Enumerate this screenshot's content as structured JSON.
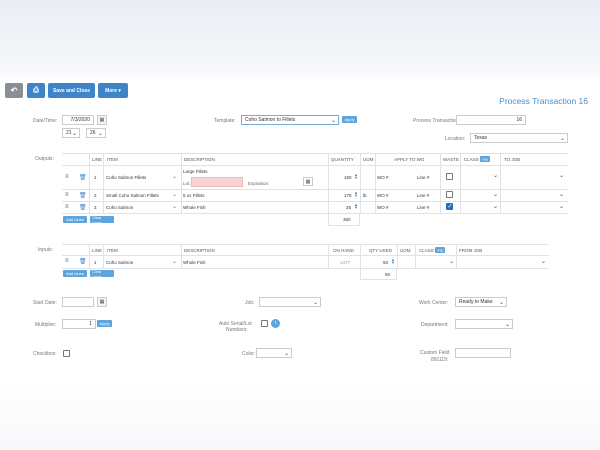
{
  "toolbar": {
    "back_icon": "undo-arrow-icon",
    "print_icon": "printer-icon",
    "save_close_label": "Save and Close",
    "more_label": "More ▾"
  },
  "page_title": "Process Transaction 16",
  "header": {
    "datetime_label": "Date/Time:",
    "date_value": "7/3/2020",
    "hour_value": "21",
    "minute_value": "26",
    "template_label": "Template:",
    "template_value": "Coho Salmon to Fillets",
    "apply_label": "Apply",
    "process_tx_label": "Process Transaction #:",
    "process_tx_value": "16",
    "location_label": "Location:",
    "location_value": "Texas"
  },
  "outputs": {
    "section_label": "Outputs:",
    "columns": {
      "line": "LINE",
      "item": "ITEM",
      "description": "DESCRIPTION",
      "quantity": "QUANTITY",
      "uom": "UOM",
      "apply_to_wo": "APPLY TO WO",
      "waste": "WASTE",
      "class": "CLASS",
      "fill": "Fill",
      "to_job": "TO JOB"
    },
    "rows": [
      {
        "line": "1",
        "item": "Coho Salmon Fillets",
        "description": "Large Fillets",
        "lot_label": "Lot:",
        "expiration_label": "Expiration:",
        "quantity": "150",
        "uom": "",
        "wo": "WO #",
        "line_no": "Line #",
        "waste": false
      },
      {
        "line": "2",
        "item": "Small Coho Salmon Fillets",
        "description": "5 oz Fillets",
        "quantity": "175",
        "uom": "lb",
        "wo": "WO #",
        "line_no": "Line #",
        "waste": false
      },
      {
        "line": "3",
        "item": "Coho Salmon",
        "description": "Whole Fish",
        "quantity": "25",
        "uom": "",
        "wo": "WO #",
        "line_no": "Line #",
        "waste": true
      }
    ],
    "total": "350",
    "add_lines_label": "Add Lines",
    "clear_lines_label": "Clear Lines"
  },
  "inputs": {
    "section_label": "Inputs:",
    "columns": {
      "line": "LINE",
      "item": "ITEM",
      "description": "DESCRIPTION",
      "on_hand": "ON HAND",
      "qty_used": "QTY USED",
      "uom": "UOM",
      "class": "CLASS",
      "fill": "Fill",
      "from_job": "FROM JOB"
    },
    "rows": [
      {
        "line": "1",
        "item": "Coho Salmon",
        "description": "Whole Fish",
        "on_hand": "1477",
        "qty_used": "50"
      }
    ],
    "total": "50",
    "add_lines_label": "Add Lines",
    "clear_lines_label": "Clear Lines"
  },
  "footer": {
    "start_date_label": "Start Date:",
    "job_label": "Job:",
    "work_center_label": "Work Center:",
    "work_center_value": "Ready to Make",
    "multiplier_label": "Multiplier:",
    "multiplier_value": "1",
    "apply_label": "Apply",
    "auto_serial_label": "Auto Serial/Lot",
    "numbers_label": "Numbers:",
    "department_label": "Department:",
    "checkbox_label": "Checkbox:",
    "color_label": "Color:",
    "custom_field_label": "Custom Field",
    "custom_field_id": "891119:"
  }
}
